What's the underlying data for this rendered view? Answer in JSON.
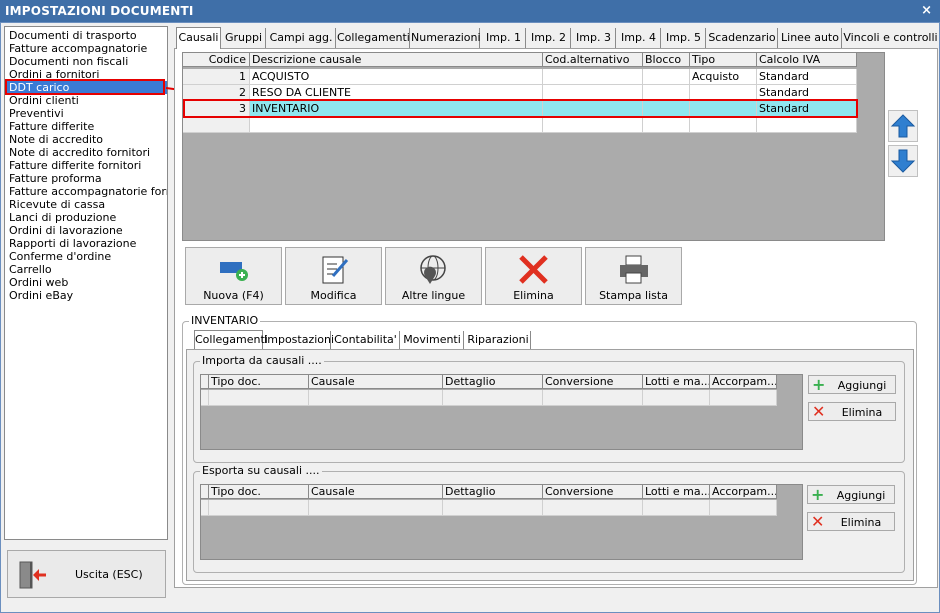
{
  "window": {
    "title": "IMPOSTAZIONI DOCUMENTI",
    "close_label": "×"
  },
  "doc_list": {
    "items": [
      "Documenti di trasporto",
      "Fatture accompagnatorie",
      "Documenti non fiscali",
      "Ordini a fornitori",
      "DDT carico",
      "Ordini clienti",
      "Preventivi",
      "Fatture differite",
      "Note di accredito",
      "Note di accredito fornitori",
      "Fatture differite fornitori",
      "Fatture proforma",
      "Fatture accompagnatorie fornito",
      "Ricevute di cassa",
      "Lanci di produzione",
      "Ordini di lavorazione",
      "Rapporti di lavorazione",
      "Conferme d'ordine",
      "Carrello",
      "Ordini web",
      "Ordini eBay"
    ],
    "selected": "DDT carico"
  },
  "exit_button": {
    "label": "Uscita (ESC)"
  },
  "top_tabs": [
    "Causali",
    "Gruppi",
    "Campi agg.",
    "Collegamenti",
    "Numerazioni",
    "Imp. 1",
    "Imp. 2",
    "Imp. 3",
    "Imp. 4",
    "Imp. 5",
    "Scadenzario",
    "Linee auto",
    "Vincoli e controlli"
  ],
  "active_top_tab": "Causali",
  "causali_grid": {
    "columns": [
      "Codice",
      "Descrizione causale",
      "Cod.alternativo",
      "Blocco",
      "Tipo",
      "Calcolo IVA"
    ],
    "rows": [
      {
        "codice": "1",
        "descrizione": "ACQUISTO",
        "cod_alt": "",
        "blocco": "",
        "tipo": "Acquisto",
        "calcolo_iva": "Standard"
      },
      {
        "codice": "2",
        "descrizione": "RESO DA CLIENTE",
        "cod_alt": "",
        "blocco": "",
        "tipo": "",
        "calcolo_iva": "Standard"
      },
      {
        "codice": "3",
        "descrizione": "INVENTARIO",
        "cod_alt": "",
        "blocco": "",
        "tipo": "",
        "calcolo_iva": "Standard"
      }
    ],
    "selected_row": 3
  },
  "action_buttons": {
    "new": "Nuova (F4)",
    "edit": "Modifica",
    "languages": "Altre lingue",
    "delete": "Elimina",
    "print": "Stampa lista"
  },
  "detail_group": {
    "title": "INVENTARIO"
  },
  "sub_tabs": [
    "Collegamenti",
    "Impostazioni",
    "Contabilita'",
    "Movimenti",
    "Riparazioni"
  ],
  "active_sub_tab": "Collegamenti",
  "import_group": {
    "title": "Importa da causali ....",
    "columns": [
      "Tipo doc.",
      "Causale",
      "Dettaglio",
      "Conversione",
      "Lotti e ma...",
      "Accorpam..."
    ],
    "add_label": "Aggiungi",
    "delete_label": "Elimina"
  },
  "export_group": {
    "title": "Esporta su causali ....",
    "columns": [
      "Tipo doc.",
      "Causale",
      "Dettaglio",
      "Conversione",
      "Lotti e ma...",
      "Accorpam..."
    ],
    "add_label": "Aggiungi",
    "delete_label": "Elimina"
  },
  "colors": {
    "selection": "#3a7bd5",
    "highlight_row": "#8fe6ef",
    "annotation": "#e60000",
    "titlebar": "#3f6fa8"
  }
}
